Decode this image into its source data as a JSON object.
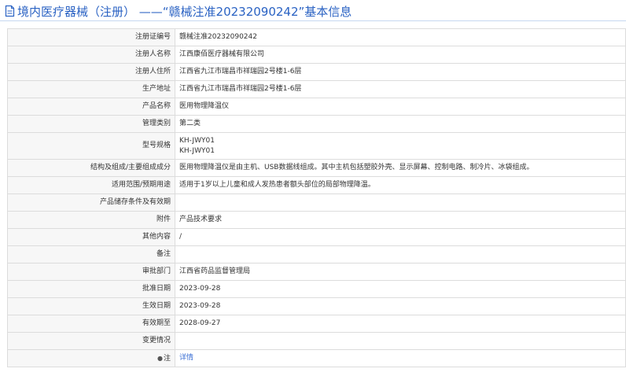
{
  "page": {
    "title": "境内医疗器械（注册） ——“赣械注准20232090242”基本信息",
    "title_color": "#2a62c3",
    "icon": "document-icon"
  },
  "rows": [
    {
      "label": "注册证编号",
      "value": "赣械注准20232090242"
    },
    {
      "label": "注册人名称",
      "value": "江西康佰医疗器械有限公司"
    },
    {
      "label": "注册人住所",
      "value": "江西省九江市瑞昌市祥瑞园2号楼1-6层"
    },
    {
      "label": "生产地址",
      "value": "江西省九江市瑞昌市祥瑞园2号楼1-6层"
    },
    {
      "label": "产品名称",
      "value": "医用物理降温仪"
    },
    {
      "label": "管理类别",
      "value": "第二类"
    },
    {
      "label": "型号规格",
      "lines": [
        "KH-JWY01",
        "KH-JWY01"
      ]
    },
    {
      "label": "结构及组成/主要组成成分",
      "value": "医用物理降温仪是由主机、USB数据线组成。其中主机包括塑胶外壳、显示屏幕、控制电路、制冷片、冰袋组成。"
    },
    {
      "label": "适用范围/预期用途",
      "value": "适用于1岁以上儿童和成人发热患者额头部位的局部物理降温。"
    },
    {
      "label": "产品储存条件及有效期",
      "value": ""
    },
    {
      "label": "附件",
      "value": "产品技术要求"
    },
    {
      "label": "其他内容",
      "value": "/"
    },
    {
      "label": "备注",
      "value": ""
    },
    {
      "label": "审批部门",
      "value": "江西省药品监督管理局"
    },
    {
      "label": "批准日期",
      "value": "2023-09-28"
    },
    {
      "label": "生效日期",
      "value": "2023-09-28"
    },
    {
      "label": "有效期至",
      "value": "2028-09-27"
    },
    {
      "label": "变更情况",
      "value": ""
    },
    {
      "label": "注",
      "icon": "location-pin-icon",
      "link": "详情",
      "link_color": "#3b6fd4"
    }
  ]
}
